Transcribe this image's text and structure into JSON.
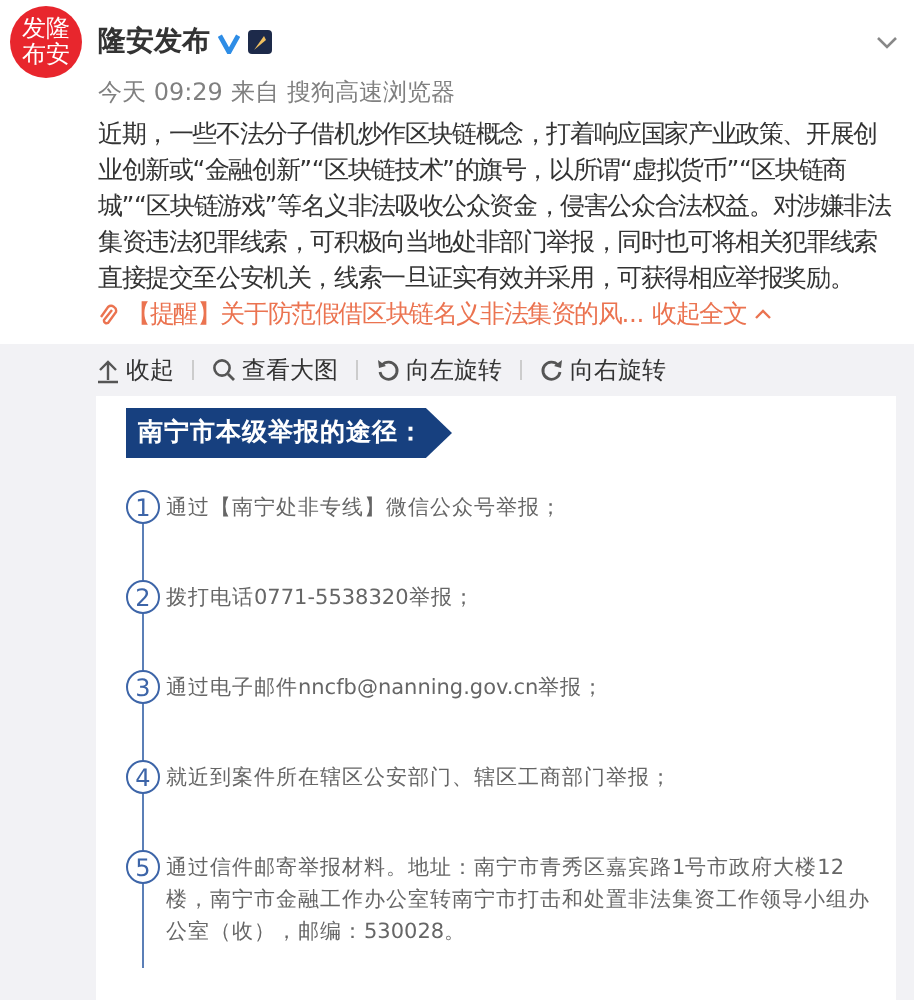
{
  "post": {
    "avatar_lines": [
      "发隆",
      "布安"
    ],
    "author": "隆安发布",
    "verified": true,
    "time": "今天 09:29",
    "source_label": "来自",
    "source": "搜狗高速浏览器",
    "body": "近期，一些不法分子借机炒作区块链概念，打着响应国家产业政策、开展创业创新或“金融创新”“区块链技术”的旗号，以所谓“虚拟货币”“区块链商城”“区块链游戏”等名义非法吸收公众资金，侵害公众合法权益。对涉嫌非法集资违法犯罪线索，可积极向当地处非部门举报，同时也可将相关犯罪线索直接提交至公安机关，线索一旦证实有效并采用，可获得相应举报奖励。",
    "link": "【提醒】关于防范假借区块链名义非法集资的风...",
    "collapse": "收起全文"
  },
  "toolbar": [
    {
      "kind": "up",
      "label": "收起"
    },
    {
      "kind": "zoom",
      "label": "查看大图"
    },
    {
      "kind": "left",
      "label": "向左旋转"
    },
    {
      "kind": "right",
      "label": "向右旋转"
    }
  ],
  "image": {
    "title": "南宁市本级举报的途径：",
    "steps": [
      {
        "number": "1",
        "text": "通过【南宁处非专线】微信公众号举报；"
      },
      {
        "number": "2",
        "text": "拨打电话0771-5538320举报；"
      },
      {
        "number": "3",
        "text": "通过电子邮件nncfb@nanning.gov.cn举报；"
      },
      {
        "number": "4",
        "text": "就近到案件所在辖区公安部门、辖区工商部门举报；"
      },
      {
        "number": "5",
        "text": "通过信件邮寄举报材料。地址：南宁市青秀区嘉宾路1号市政府大楼12楼，南宁市金融工作办公室转南宁市打击和处置非法集资工作领导小组办公室（收），邮编：530028。"
      }
    ]
  }
}
